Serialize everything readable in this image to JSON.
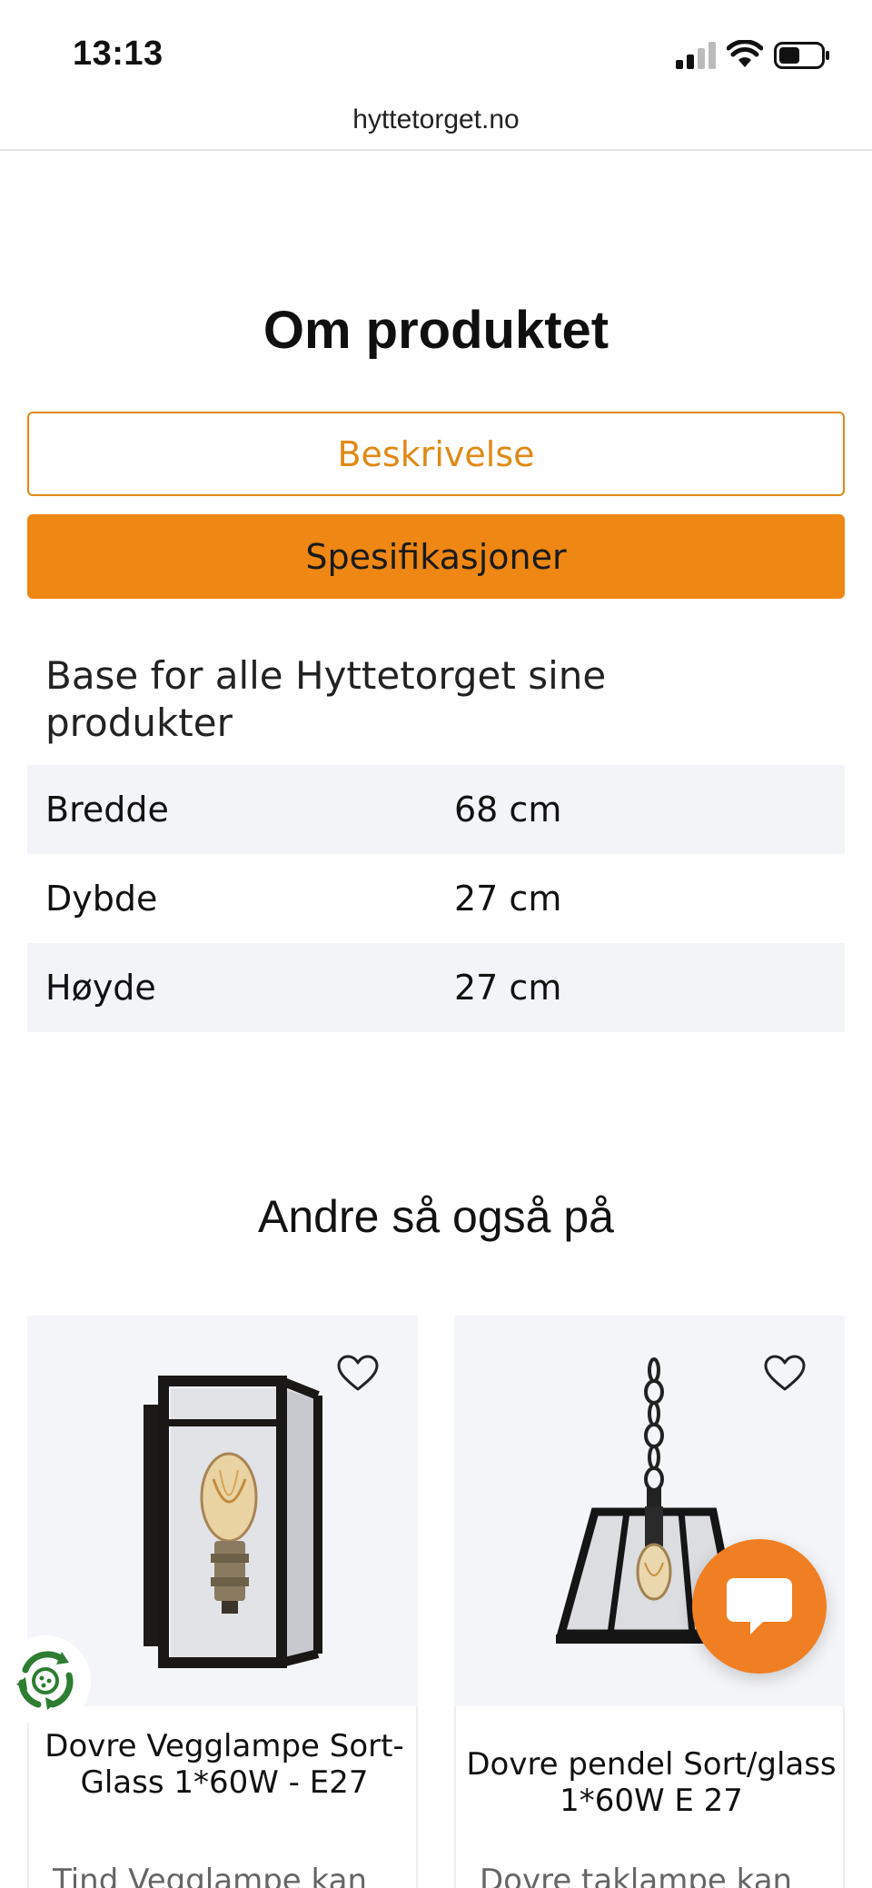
{
  "status_bar": {
    "time": "13:13"
  },
  "browser": {
    "url": "hyttetorget.no"
  },
  "about": {
    "title": "Om produktet",
    "tab_description": "Beskrivelse",
    "tab_specifications": "Spesifikasjoner",
    "spec_heading": "Base for alle Hyttetorget sine produkter",
    "specs": [
      {
        "label": "Bredde",
        "value": "68 cm"
      },
      {
        "label": "Dybde",
        "value": "27 cm"
      },
      {
        "label": "Høyde",
        "value": "27 cm"
      }
    ]
  },
  "related": {
    "title": "Andre så også på",
    "products": [
      {
        "title": "Dovre Vegglampe Sort-Glass 1*60W - E27",
        "description": "Tind Vegglampe kan"
      },
      {
        "title": "Dovre pendel Sort/glass 1*60W E 27",
        "description": "Dovre taklampe kan"
      }
    ]
  },
  "icons": {
    "heart": "heart-outline-icon",
    "chat": "chat-bubble-icon",
    "eco": "recycle-badge-icon"
  },
  "colors": {
    "accent": "#ee8714",
    "accent_text": "#e08a17",
    "chat": "#ef7f22",
    "eco": "#2e7d32"
  }
}
